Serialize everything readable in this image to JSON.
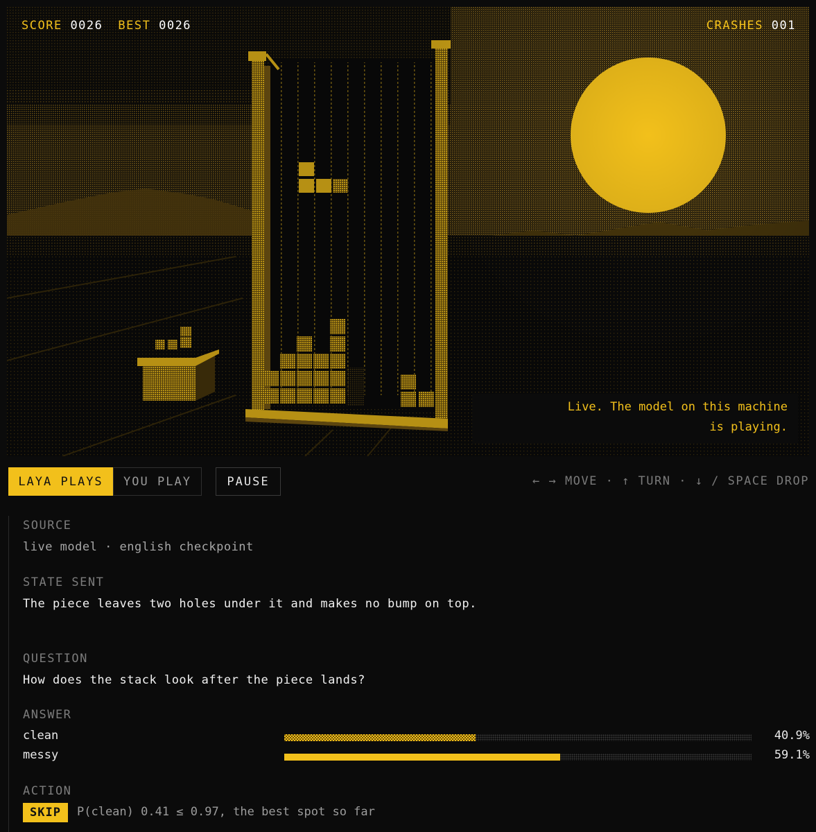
{
  "hud": {
    "score_label": "SCORE",
    "score_value": "0026",
    "best_label": "BEST",
    "best_value": "0026",
    "crashes_label": "CRASHES",
    "crashes_value": "001"
  },
  "status_message": "Live. The model on this machine\nis playing.",
  "controls": {
    "laya_plays": "LAYA PLAYS",
    "you_play": "YOU PLAY",
    "pause": "PAUSE",
    "keys_hint": "← → MOVE · ↑ TURN · ↓ / SPACE DROP",
    "active_mode": "laya_plays"
  },
  "panel": {
    "source": {
      "label": "SOURCE",
      "value": "live model · english checkpoint"
    },
    "state_sent": {
      "label": "STATE SENT",
      "value": "The piece leaves two holes under it and makes no bump on top."
    },
    "question": {
      "label": "QUESTION",
      "value": "How does the stack look after the piece lands?"
    },
    "answer": {
      "label": "ANSWER",
      "options": [
        {
          "name": "clean",
          "pct": "40.9%",
          "fraction": 0.409,
          "style": "dither"
        },
        {
          "name": "messy",
          "pct": "59.1%",
          "fraction": 0.591,
          "style": "solid"
        }
      ]
    },
    "action": {
      "label": "ACTION",
      "badge": "SKIP",
      "text": "P(clean) 0.41 ≤ 0.97, the best spot so far"
    }
  },
  "colors": {
    "accent": "#f2c01b",
    "background": "#0b0b0b",
    "muted": "#7c7c7c",
    "scene_dither": "#7a5c14"
  },
  "icons": [
    "sun-icon",
    "tetris-well",
    "falling-piece",
    "side-crate"
  ]
}
